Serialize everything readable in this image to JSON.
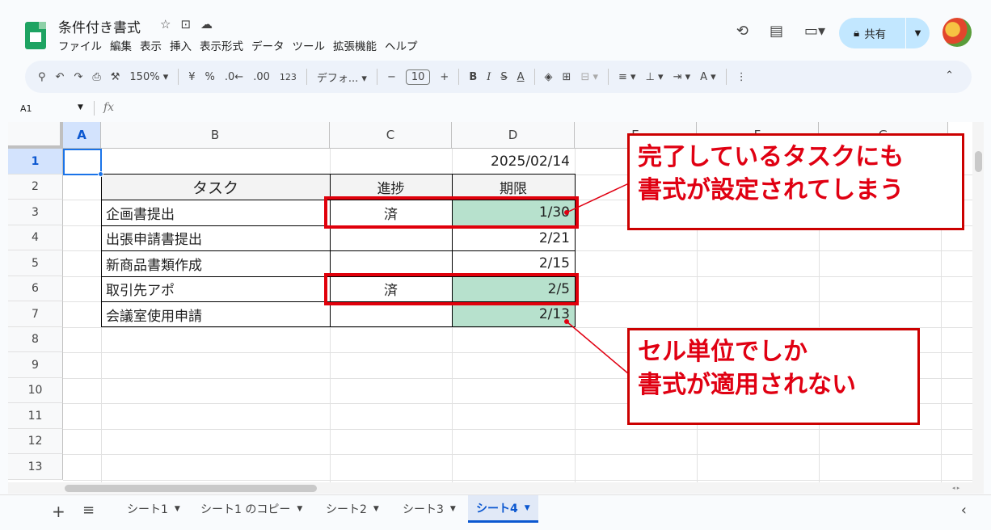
{
  "header": {
    "title": "条件付き書式",
    "menu": [
      "ファイル",
      "編集",
      "表示",
      "挿入",
      "表示形式",
      "データ",
      "ツール",
      "拡張機能",
      "ヘルプ"
    ],
    "share_label": "共有"
  },
  "toolbar": {
    "zoom": "150%",
    "currency": "¥",
    "percent": "%",
    "dec_decrease": ".0←",
    "dec_increase": ".00",
    "number_format": "123",
    "font": "デフォ...",
    "font_size": "10",
    "bold": "B",
    "italic": "I",
    "strike": "S",
    "text_color": "A"
  },
  "formula_bar": {
    "name_box": "A1",
    "fx": "fx"
  },
  "columns": [
    "A",
    "B",
    "C",
    "D",
    "E",
    "F",
    "G"
  ],
  "rows": [
    "1",
    "2",
    "3",
    "4",
    "5",
    "6",
    "7",
    "8",
    "9",
    "10",
    "11",
    "12",
    "13"
  ],
  "cells": {
    "D1": "2025/02/14",
    "B2": "タスク",
    "C2": "進捗",
    "D2": "期限",
    "B3": "企画書提出",
    "C3": "済",
    "D3": "1/30",
    "B4": "出張申請書提出",
    "D4": "2/21",
    "B5": "新商品書類作成",
    "D5": "2/15",
    "B6": "取引先アポ",
    "C6": "済",
    "D6": "2/5",
    "B7": "会議室使用申請",
    "D7": "2/13"
  },
  "callouts": {
    "top": [
      "完了しているタスクにも",
      "書式が設定されてしまう"
    ],
    "bottom": [
      "セル単位でしか",
      "書式が適用されない"
    ]
  },
  "sheets": [
    "シート1",
    "シート1 のコピー",
    "シート2",
    "シート3",
    "シート4"
  ],
  "active_sheet": "シート4",
  "colors": {
    "highlight": "#b7e1cd",
    "annotation": "#e00012",
    "selection": "#1a73e8"
  }
}
